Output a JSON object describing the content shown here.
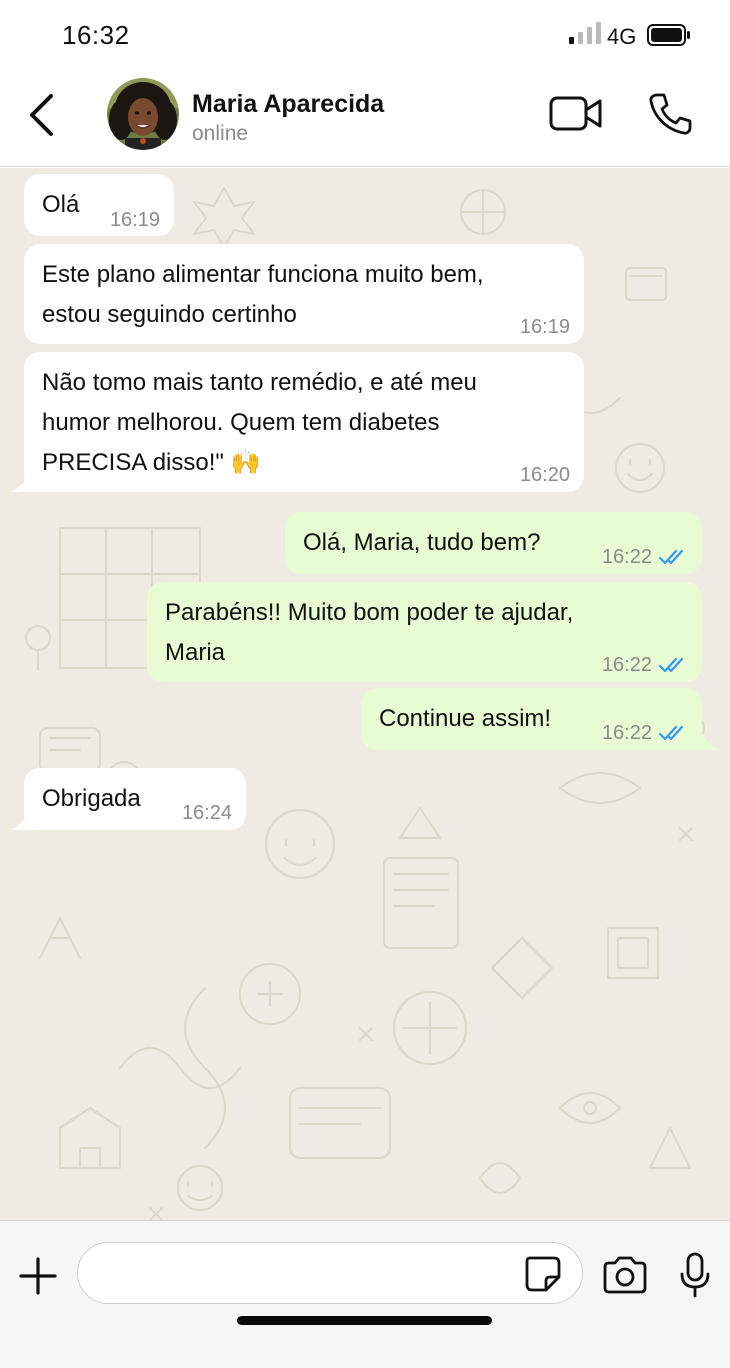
{
  "status_bar": {
    "time": "16:32",
    "network": "4G",
    "signal_icon": "signal-bars-icon",
    "battery_icon": "battery-icon"
  },
  "header": {
    "back_icon": "chevron-left-icon",
    "contact_name": "Maria Aparecida",
    "contact_status": "online",
    "video_icon": "video-camera-icon",
    "call_icon": "phone-icon"
  },
  "messages": [
    {
      "direction": "in",
      "lines": [
        "Olá"
      ],
      "time": "16:19"
    },
    {
      "direction": "in",
      "lines": [
        "Este plano alimentar funciona muito bem,",
        "estou seguindo certinho"
      ],
      "time": "16:19"
    },
    {
      "direction": "in",
      "lines": [
        "Não tomo mais tanto remédio, e até meu",
        "humor melhorou. Quem tem diabetes",
        "PRECISA disso!\" 🙌"
      ],
      "time": "16:20"
    },
    {
      "direction": "out",
      "lines": [
        "Olá, Maria, tudo bem?"
      ],
      "time": "16:22",
      "status": "read"
    },
    {
      "direction": "out",
      "lines": [
        "Parabéns!! Muito bom poder te ajudar,",
        "Maria"
      ],
      "time": "16:22",
      "status": "read"
    },
    {
      "direction": "out",
      "lines": [
        "Continue assim!"
      ],
      "time": "16:22",
      "status": "read"
    },
    {
      "direction": "in",
      "lines": [
        "Obrigada"
      ],
      "time": "16:24"
    }
  ],
  "input_bar": {
    "placeholder": "",
    "plus_icon": "plus-icon",
    "sticker_icon": "sticker-icon",
    "camera_icon": "camera-icon",
    "mic_icon": "microphone-icon"
  },
  "colors": {
    "chat_background": "#efeae2",
    "incoming_bubble": "#ffffff",
    "outgoing_bubble": "#e7fcd3",
    "read_ticks": "#3497f9",
    "timestamp": "#8b8b8b"
  }
}
